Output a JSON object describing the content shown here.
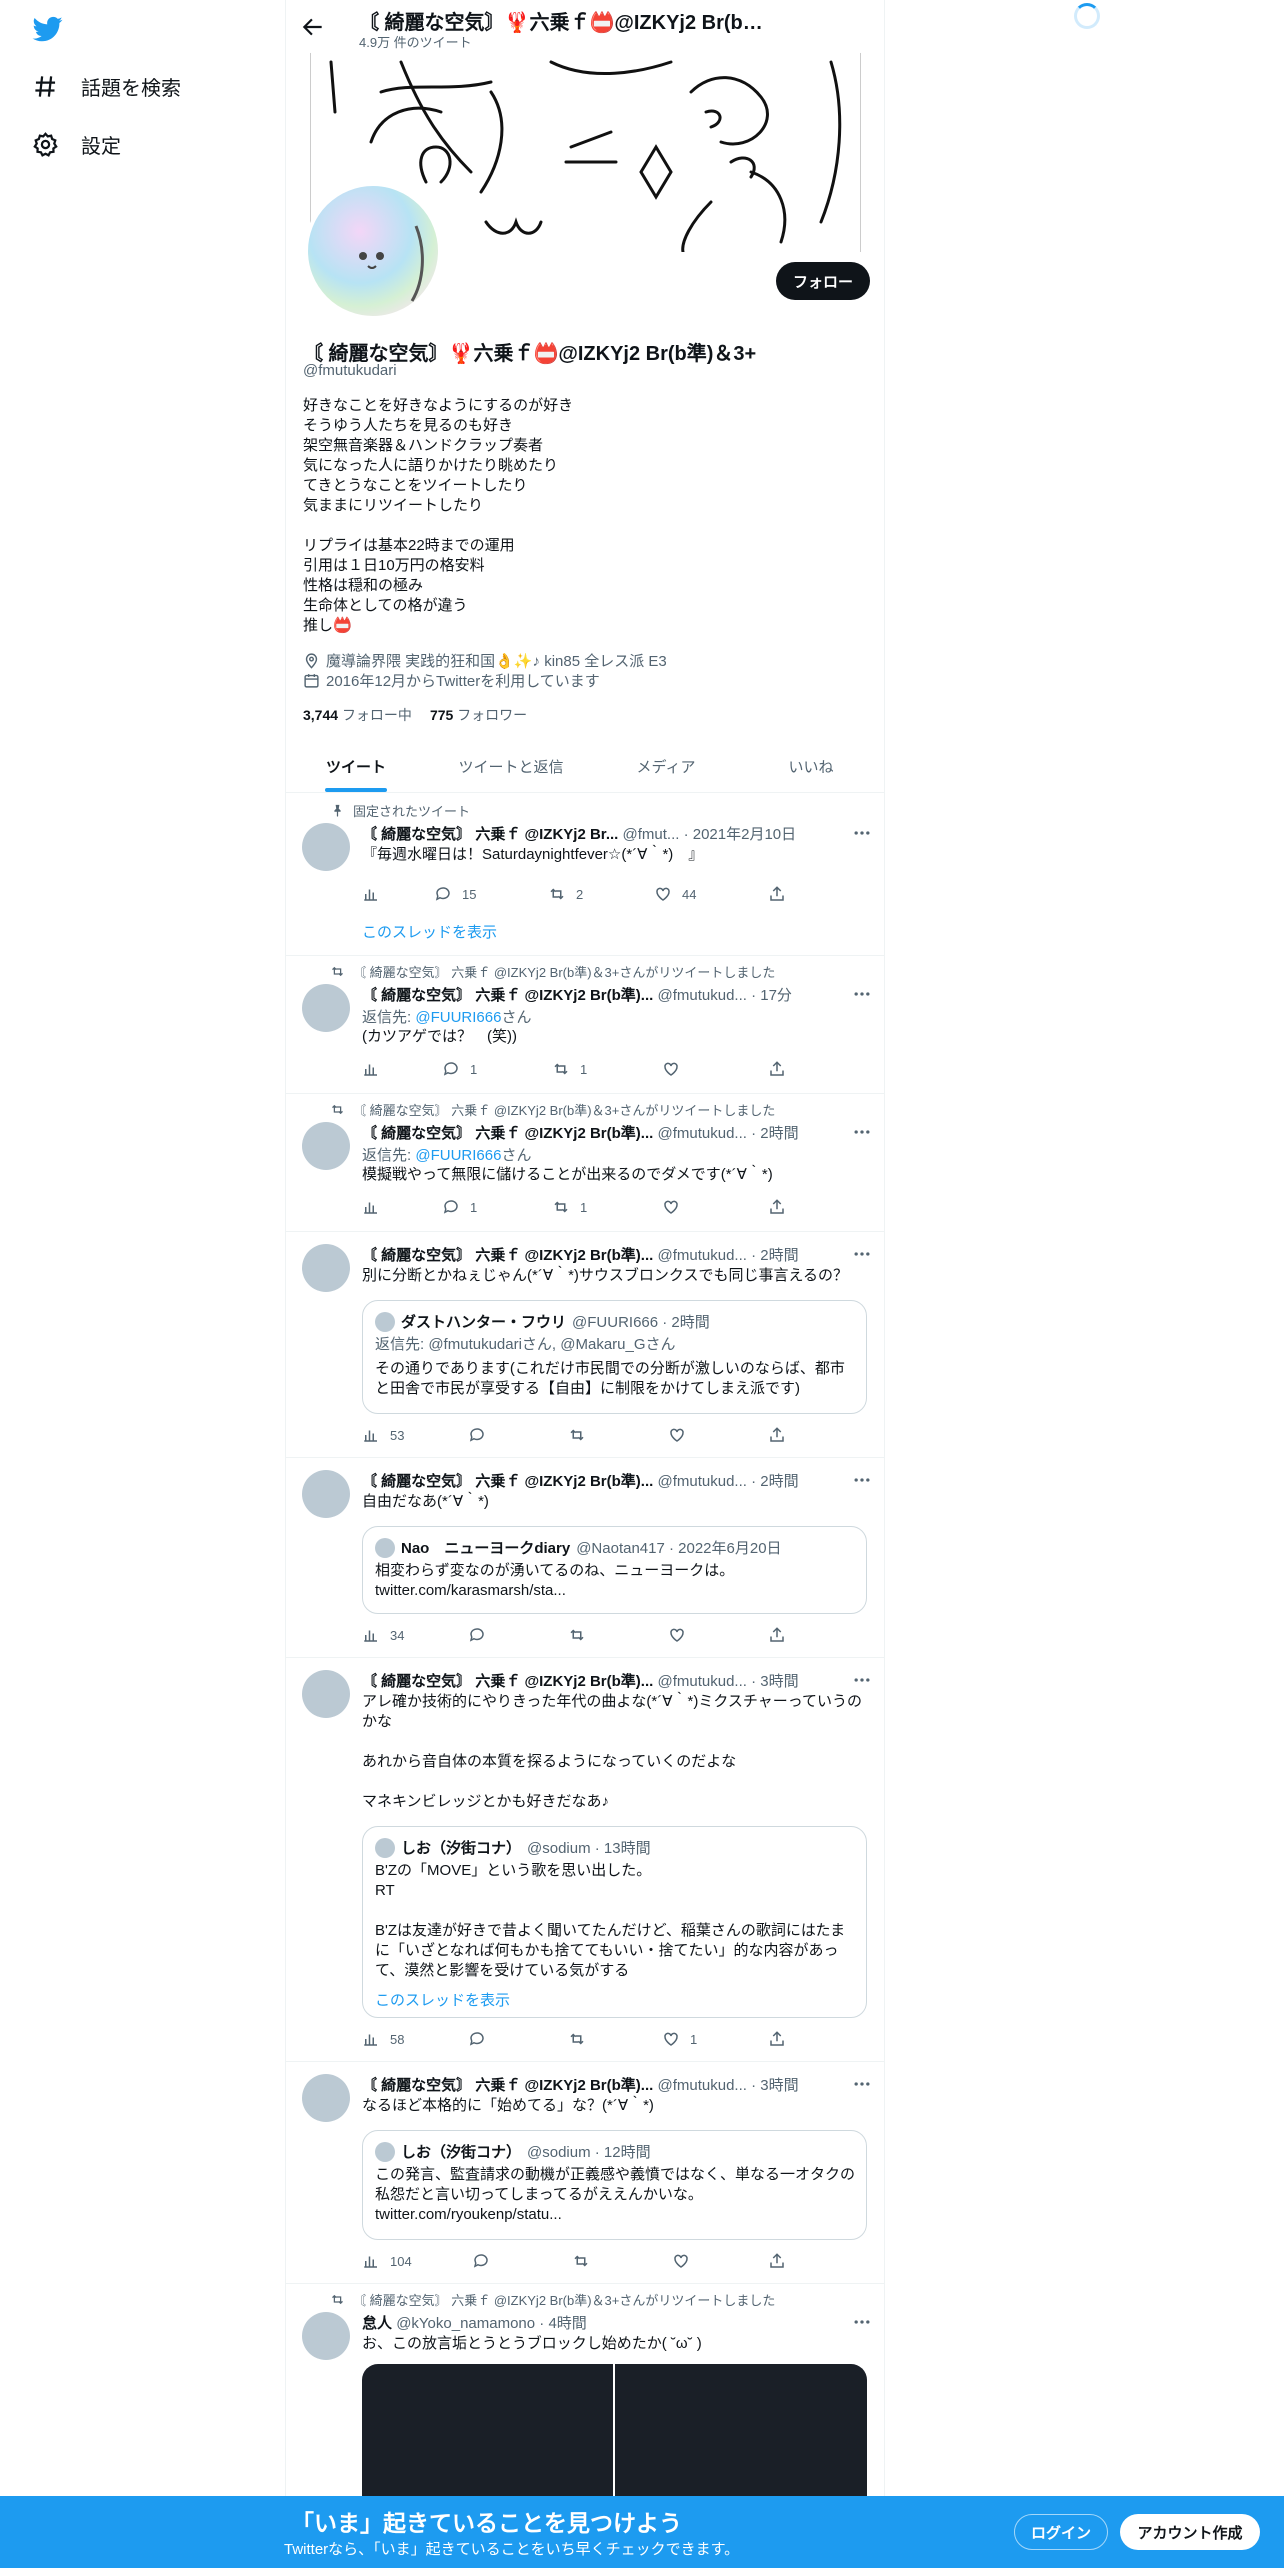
{
  "sidebar": {
    "items": [
      {
        "label": "話題を検索",
        "icon": "hashtag-icon"
      },
      {
        "label": "設定",
        "icon": "gear-icon"
      }
    ]
  },
  "header": {
    "title": "〘 綺麗な空気〙🦞六乗ｆ📛@IZKYj2 Br(b準...",
    "tweet_count": "4.9万 件のツイート"
  },
  "profile": {
    "follow_label": "フォロー",
    "name": "〘 綺麗な空気〙🦞六乗ｆ📛@IZKYj2 Br(b準)＆3+",
    "handle": "@fmutukudari",
    "bio": "好きなことを好きなようにするのが好き\nそうゆう人たちを見るのも好き\n架空無音楽器＆ハンドクラップ奏者\n気になった人に語りかけたり眺めたり\nてきとうなことをツイートしたり\n気ままにリツイートしたり\n\nリプライは基本22時までの運用\n引用は１日10万円の格安料\n性格は穏和の極み\n生命体としての格が違う\n推し📛",
    "location": "魔導論界隈 実践的狂和国👌✨♪ kin85 全レス派 E3",
    "joined": "2016年12月からTwitterを利用しています",
    "following_count": "3,744",
    "following_label": "フォロー中",
    "followers_count": "775",
    "followers_label": "フォロワー"
  },
  "tabs": [
    {
      "label": "ツイート",
      "active": true
    },
    {
      "label": "ツイートと返信",
      "active": false
    },
    {
      "label": "メディア",
      "active": false
    },
    {
      "label": "いいね",
      "active": false
    }
  ],
  "tweets": [
    {
      "context": "固定されたツイート",
      "header_name": "〘 綺麗な空気〙 六乗ｆ @IZKYj2 Br...",
      "header_meta": "@fmut... · 2021年2月10日",
      "text": "『毎週水曜日は！Saturdaynightfever☆(*´∀｀*)　』",
      "views": "",
      "replies": "15",
      "retweets": "2",
      "likes": "44",
      "show_thread": "このスレッドを表示"
    },
    {
      "context": "〘 綺麗な空気〙 六乗ｆ @IZKYj2 Br(b準)＆3+さんがリツイートしました",
      "header_name": "〘 綺麗な空気〙 六乗ｆ @IZKYj2 Br(b準)...",
      "header_meta": "@fmutukud... · 17分",
      "reply_prefix": "返信先:",
      "reply_to": "@FUURI666",
      "reply_suffix": "さん",
      "text": "(カツアゲでは？　(笑))",
      "replies": "1",
      "retweets": "1",
      "likes": ""
    },
    {
      "context": "〘 綺麗な空気〙 六乗ｆ @IZKYj2 Br(b準)＆3+さんがリツイートしました",
      "header_name": "〘 綺麗な空気〙 六乗ｆ @IZKYj2 Br(b準)...",
      "header_meta": "@fmutukud... · 2時間",
      "reply_prefix": "返信先:",
      "reply_to": "@FUURI666",
      "reply_suffix": "さん",
      "text": "模擬戦やって無限に儲けることが出来るのでダメです(*´∀｀*)",
      "replies": "1",
      "retweets": "1",
      "likes": ""
    },
    {
      "header_name": "〘 綺麗な空気〙 六乗ｆ @IZKYj2 Br(b準)...",
      "header_meta": "@fmutukud... · 2時間",
      "text": "別に分断とかねぇじゃん(*´∀｀*)サウスブロンクスでも同じ事言えるの？",
      "quote": {
        "name": "ダストハンター・フウリ",
        "meta": "@FUURI666 · 2時間",
        "reply_line": "返信先: @fmutukudariさん, @Makaru_Gさん",
        "text": "その通りであります(これだけ市民間での分断が激しいのならば、都市と田舎で市民が享受する【自由】に制限をかけてしまえ派です)"
      },
      "views": "53"
    },
    {
      "header_name": "〘 綺麗な空気〙 六乗ｆ @IZKYj2 Br(b準)...",
      "header_meta": "@fmutukud... · 2時間",
      "text": "自由だなあ(*´∀｀*)",
      "quote": {
        "name": "Nao　ニューヨークdiary",
        "meta": "@Naotan417 · 2022年6月20日",
        "text": "相変わらず変なのが湧いてるのね、ニューヨークは。\ntwitter.com/karasmarsh/sta..."
      },
      "views": "34"
    },
    {
      "header_name": "〘 綺麗な空気〙 六乗ｆ @IZKYj2 Br(b準)...",
      "header_meta": "@fmutukud... · 3時間",
      "text": "アレ確か技術的にやりきった年代の曲よな(*´∀｀*)ミクスチャーっていうのかな\n\nあれから音自体の本質を探るようになっていくのだよな\n\nマネキンビレッジとかも好きだなあ♪",
      "quote": {
        "name": "しお（汐街コナ）",
        "meta": "@sodium · 13時間",
        "text": "B'Zの「MOVE」という歌を思い出した。\nRT\n\nB'Zは友達が好きで昔よく聞いてたんだけど、稲葉さんの歌詞にはたまに「いざとなれば何もかも捨ててもいい・捨てたい」的な内容があって、漠然と影響を受けている気がする",
        "show_thread": "このスレッドを表示"
      },
      "views": "58",
      "likes": "1"
    },
    {
      "header_name": "〘 綺麗な空気〙 六乗ｆ @IZKYj2 Br(b準)...",
      "header_meta": "@fmutukud... · 3時間",
      "text": "なるほど本格的に「始めてる」な？(*´∀｀*)",
      "quote": {
        "name": "しお（汐街コナ）",
        "meta": "@sodium · 12時間",
        "text": "この発言、監査請求の動機が正義感や義憤ではなく、単なる一オタクの私怨だと言い切ってしまってるがええんかいな。\ntwitter.com/ryoukenp/statu..."
      },
      "views": "104"
    },
    {
      "context": "〘 綺麗な空気〙 六乗ｆ @IZKYj2 Br(b準)＆3+さんがリツイートしました",
      "header_name": "怠人",
      "header_meta": "@kYoko_namamono · 4時間",
      "text": "お、この放言垢とうとうブロックし始めたか( ˘ω˘ )"
    }
  ],
  "bottom_bar": {
    "title": "「いま」起きていることを見つけよう",
    "subtitle": "Twitterなら、「いま」起きていることをいち早くチェックできます。",
    "login_label": "ログイン",
    "signup_label": "アカウント作成"
  },
  "colors": {
    "accent": "#1d9bf0",
    "text": "#0f1419",
    "secondary": "#536471"
  }
}
